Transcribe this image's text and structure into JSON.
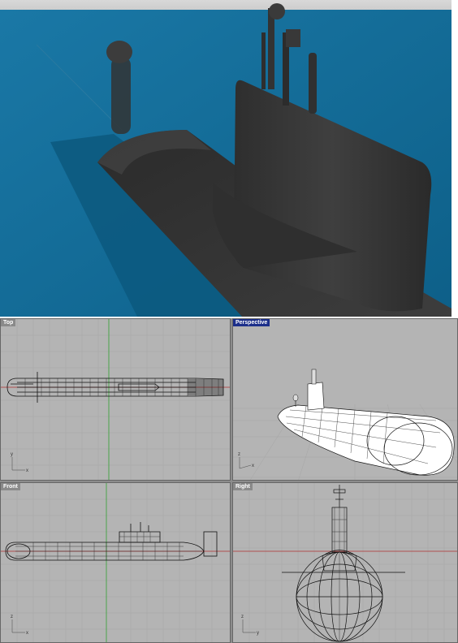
{
  "viewports": {
    "top": {
      "label": "Top"
    },
    "perspective": {
      "label": "Perspective"
    },
    "front": {
      "label": "Front"
    },
    "right": {
      "label": "Right"
    }
  },
  "axis_labels": {
    "x": "x",
    "y": "y",
    "z": "z"
  },
  "colors": {
    "water": "#0f6a96",
    "hull": "#3a3a3a",
    "viewport_bg": "#b4b4b4",
    "grid_line": "#a6a6a6",
    "active_label": "#1c2f8a",
    "x_axis": "#b03030",
    "y_axis": "#30a030"
  }
}
